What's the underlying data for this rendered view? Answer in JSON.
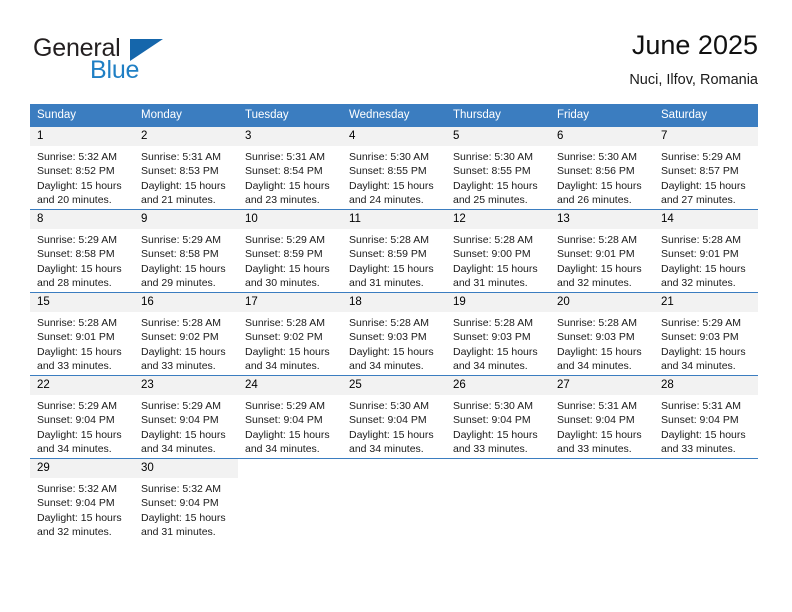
{
  "brand": {
    "name_part1": "General",
    "name_part2": "Blue",
    "flag_icon": "blue-flag-triangle"
  },
  "header": {
    "title": "June 2025",
    "location": "Nuci, Ilfov, Romania"
  },
  "colors": {
    "header_blue": "#3b7dc0",
    "brand_blue": "#1f7fc4",
    "daynum_bg": "#f2f2f2",
    "text": "#1a1a1a"
  },
  "calendar": {
    "weekday_headers": [
      "Sunday",
      "Monday",
      "Tuesday",
      "Wednesday",
      "Thursday",
      "Friday",
      "Saturday"
    ],
    "weeks": [
      [
        {
          "day": "1",
          "sunrise": "Sunrise: 5:32 AM",
          "sunset": "Sunset: 8:52 PM",
          "daylight_line1": "Daylight: 15 hours",
          "daylight_line2": "and 20 minutes."
        },
        {
          "day": "2",
          "sunrise": "Sunrise: 5:31 AM",
          "sunset": "Sunset: 8:53 PM",
          "daylight_line1": "Daylight: 15 hours",
          "daylight_line2": "and 21 minutes."
        },
        {
          "day": "3",
          "sunrise": "Sunrise: 5:31 AM",
          "sunset": "Sunset: 8:54 PM",
          "daylight_line1": "Daylight: 15 hours",
          "daylight_line2": "and 23 minutes."
        },
        {
          "day": "4",
          "sunrise": "Sunrise: 5:30 AM",
          "sunset": "Sunset: 8:55 PM",
          "daylight_line1": "Daylight: 15 hours",
          "daylight_line2": "and 24 minutes."
        },
        {
          "day": "5",
          "sunrise": "Sunrise: 5:30 AM",
          "sunset": "Sunset: 8:55 PM",
          "daylight_line1": "Daylight: 15 hours",
          "daylight_line2": "and 25 minutes."
        },
        {
          "day": "6",
          "sunrise": "Sunrise: 5:30 AM",
          "sunset": "Sunset: 8:56 PM",
          "daylight_line1": "Daylight: 15 hours",
          "daylight_line2": "and 26 minutes."
        },
        {
          "day": "7",
          "sunrise": "Sunrise: 5:29 AM",
          "sunset": "Sunset: 8:57 PM",
          "daylight_line1": "Daylight: 15 hours",
          "daylight_line2": "and 27 minutes."
        }
      ],
      [
        {
          "day": "8",
          "sunrise": "Sunrise: 5:29 AM",
          "sunset": "Sunset: 8:58 PM",
          "daylight_line1": "Daylight: 15 hours",
          "daylight_line2": "and 28 minutes."
        },
        {
          "day": "9",
          "sunrise": "Sunrise: 5:29 AM",
          "sunset": "Sunset: 8:58 PM",
          "daylight_line1": "Daylight: 15 hours",
          "daylight_line2": "and 29 minutes."
        },
        {
          "day": "10",
          "sunrise": "Sunrise: 5:29 AM",
          "sunset": "Sunset: 8:59 PM",
          "daylight_line1": "Daylight: 15 hours",
          "daylight_line2": "and 30 minutes."
        },
        {
          "day": "11",
          "sunrise": "Sunrise: 5:28 AM",
          "sunset": "Sunset: 8:59 PM",
          "daylight_line1": "Daylight: 15 hours",
          "daylight_line2": "and 31 minutes."
        },
        {
          "day": "12",
          "sunrise": "Sunrise: 5:28 AM",
          "sunset": "Sunset: 9:00 PM",
          "daylight_line1": "Daylight: 15 hours",
          "daylight_line2": "and 31 minutes."
        },
        {
          "day": "13",
          "sunrise": "Sunrise: 5:28 AM",
          "sunset": "Sunset: 9:01 PM",
          "daylight_line1": "Daylight: 15 hours",
          "daylight_line2": "and 32 minutes."
        },
        {
          "day": "14",
          "sunrise": "Sunrise: 5:28 AM",
          "sunset": "Sunset: 9:01 PM",
          "daylight_line1": "Daylight: 15 hours",
          "daylight_line2": "and 32 minutes."
        }
      ],
      [
        {
          "day": "15",
          "sunrise": "Sunrise: 5:28 AM",
          "sunset": "Sunset: 9:01 PM",
          "daylight_line1": "Daylight: 15 hours",
          "daylight_line2": "and 33 minutes."
        },
        {
          "day": "16",
          "sunrise": "Sunrise: 5:28 AM",
          "sunset": "Sunset: 9:02 PM",
          "daylight_line1": "Daylight: 15 hours",
          "daylight_line2": "and 33 minutes."
        },
        {
          "day": "17",
          "sunrise": "Sunrise: 5:28 AM",
          "sunset": "Sunset: 9:02 PM",
          "daylight_line1": "Daylight: 15 hours",
          "daylight_line2": "and 34 minutes."
        },
        {
          "day": "18",
          "sunrise": "Sunrise: 5:28 AM",
          "sunset": "Sunset: 9:03 PM",
          "daylight_line1": "Daylight: 15 hours",
          "daylight_line2": "and 34 minutes."
        },
        {
          "day": "19",
          "sunrise": "Sunrise: 5:28 AM",
          "sunset": "Sunset: 9:03 PM",
          "daylight_line1": "Daylight: 15 hours",
          "daylight_line2": "and 34 minutes."
        },
        {
          "day": "20",
          "sunrise": "Sunrise: 5:28 AM",
          "sunset": "Sunset: 9:03 PM",
          "daylight_line1": "Daylight: 15 hours",
          "daylight_line2": "and 34 minutes."
        },
        {
          "day": "21",
          "sunrise": "Sunrise: 5:29 AM",
          "sunset": "Sunset: 9:03 PM",
          "daylight_line1": "Daylight: 15 hours",
          "daylight_line2": "and 34 minutes."
        }
      ],
      [
        {
          "day": "22",
          "sunrise": "Sunrise: 5:29 AM",
          "sunset": "Sunset: 9:04 PM",
          "daylight_line1": "Daylight: 15 hours",
          "daylight_line2": "and 34 minutes."
        },
        {
          "day": "23",
          "sunrise": "Sunrise: 5:29 AM",
          "sunset": "Sunset: 9:04 PM",
          "daylight_line1": "Daylight: 15 hours",
          "daylight_line2": "and 34 minutes."
        },
        {
          "day": "24",
          "sunrise": "Sunrise: 5:29 AM",
          "sunset": "Sunset: 9:04 PM",
          "daylight_line1": "Daylight: 15 hours",
          "daylight_line2": "and 34 minutes."
        },
        {
          "day": "25",
          "sunrise": "Sunrise: 5:30 AM",
          "sunset": "Sunset: 9:04 PM",
          "daylight_line1": "Daylight: 15 hours",
          "daylight_line2": "and 34 minutes."
        },
        {
          "day": "26",
          "sunrise": "Sunrise: 5:30 AM",
          "sunset": "Sunset: 9:04 PM",
          "daylight_line1": "Daylight: 15 hours",
          "daylight_line2": "and 33 minutes."
        },
        {
          "day": "27",
          "sunrise": "Sunrise: 5:31 AM",
          "sunset": "Sunset: 9:04 PM",
          "daylight_line1": "Daylight: 15 hours",
          "daylight_line2": "and 33 minutes."
        },
        {
          "day": "28",
          "sunrise": "Sunrise: 5:31 AM",
          "sunset": "Sunset: 9:04 PM",
          "daylight_line1": "Daylight: 15 hours",
          "daylight_line2": "and 33 minutes."
        }
      ],
      [
        {
          "day": "29",
          "sunrise": "Sunrise: 5:32 AM",
          "sunset": "Sunset: 9:04 PM",
          "daylight_line1": "Daylight: 15 hours",
          "daylight_line2": "and 32 minutes."
        },
        {
          "day": "30",
          "sunrise": "Sunrise: 5:32 AM",
          "sunset": "Sunset: 9:04 PM",
          "daylight_line1": "Daylight: 15 hours",
          "daylight_line2": "and 31 minutes."
        },
        {
          "day": "",
          "sunrise": "",
          "sunset": "",
          "daylight_line1": "",
          "daylight_line2": ""
        },
        {
          "day": "",
          "sunrise": "",
          "sunset": "",
          "daylight_line1": "",
          "daylight_line2": ""
        },
        {
          "day": "",
          "sunrise": "",
          "sunset": "",
          "daylight_line1": "",
          "daylight_line2": ""
        },
        {
          "day": "",
          "sunrise": "",
          "sunset": "",
          "daylight_line1": "",
          "daylight_line2": ""
        },
        {
          "day": "",
          "sunrise": "",
          "sunset": "",
          "daylight_line1": "",
          "daylight_line2": ""
        }
      ]
    ]
  }
}
